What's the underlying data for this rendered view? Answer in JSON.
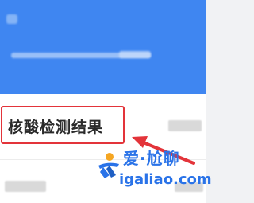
{
  "list": {
    "item_title": "核酸检测结果"
  },
  "watermark": {
    "brand": "爱·尬聊",
    "url": "igaliao.com"
  },
  "colors": {
    "header": "#3f86f1",
    "highlight": "#e3343a",
    "watermark": "#2a73e8"
  }
}
